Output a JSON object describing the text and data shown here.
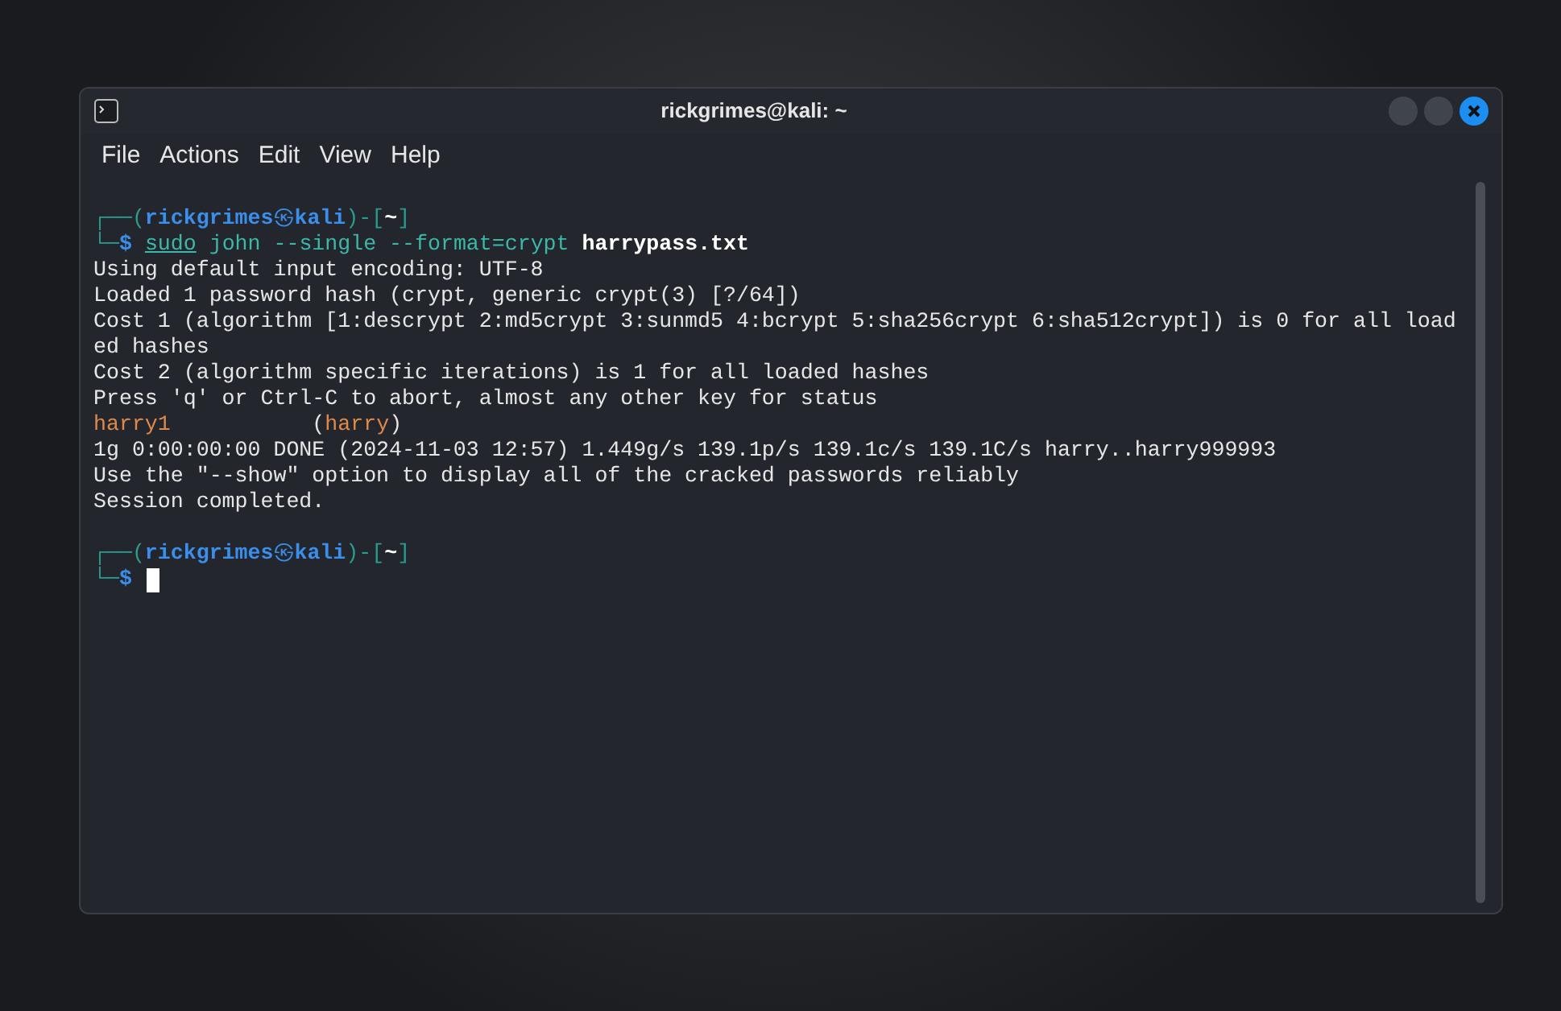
{
  "window": {
    "title": "rickgrimes@kali: ~"
  },
  "menu": [
    "File",
    "Actions",
    "Edit",
    "View",
    "Help"
  ],
  "terminal": {
    "lines": [
      {
        "kind": "prompt",
        "top": "┌──(",
        "user": "rickgrimes",
        "at": "㉿",
        "host": "kali",
        "mid": ")-[",
        "dir": "~",
        "close": "]"
      },
      {
        "kind": "command",
        "corner": "└─",
        "dollar": "$",
        "tokens": [
          {
            "kind": "sudo",
            "text": "sudo"
          },
          {
            "kind": "arg",
            "text": " john --single --format=crypt "
          },
          {
            "kind": "file",
            "text": "harrypass.txt"
          }
        ]
      },
      {
        "kind": "output",
        "text": "Using default input encoding: UTF-8"
      },
      {
        "kind": "output",
        "text": "Loaded 1 password hash (crypt, generic crypt(3) [?/64])"
      },
      {
        "kind": "output",
        "text": "Cost 1 (algorithm [1:descrypt 2:md5crypt 3:sunmd5 4:bcrypt 5:sha256crypt 6:sha512crypt]) is 0 for all load"
      },
      {
        "kind": "output",
        "text": "ed hashes"
      },
      {
        "kind": "output",
        "text": "Cost 2 (algorithm specific iterations) is 1 for all loaded hashes"
      },
      {
        "kind": "output",
        "text": "Press 'q' or Ctrl-C to abort, almost any other key for status"
      },
      {
        "kind": "cracked",
        "password": "harry1",
        "open": "(",
        "login": "harry",
        "close": ")"
      },
      {
        "kind": "output",
        "text": "1g 0:00:00:00 DONE (2024-11-03 12:57) 1.449g/s 139.1p/s 139.1c/s 139.1C/s harry..harry999993"
      },
      {
        "kind": "output",
        "text": "Use the \"--show\" option to display all of the cracked passwords reliably"
      },
      {
        "kind": "output",
        "text": "Session completed."
      },
      {
        "kind": "blank"
      },
      {
        "kind": "prompt",
        "top": "┌──(",
        "user": "rickgrimes",
        "at": "㉿",
        "host": "kali",
        "mid": ")-[",
        "dir": "~",
        "close": "]"
      },
      {
        "kind": "input",
        "corner": "└─",
        "dollar": "$"
      }
    ]
  }
}
